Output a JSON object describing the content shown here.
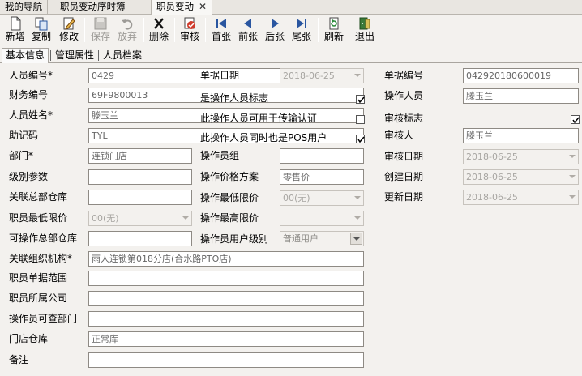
{
  "doc_tabs": {
    "nav": "我的导航",
    "list": "职员变动序时簿",
    "active": "职员变动",
    "close": "✕"
  },
  "toolbar": {
    "new": "新增",
    "copy": "复制",
    "edit": "修改",
    "save": "保存",
    "discard": "放弃",
    "delete": "删除",
    "audit": "审核",
    "first": "首张",
    "prev": "前张",
    "next": "后张",
    "last": "尾张",
    "refresh": "刷新",
    "exit": "退出"
  },
  "subtabs": {
    "basic": "基本信息",
    "mgmt": "管理属性",
    "archive": "人员档案"
  },
  "form": {
    "col1": {
      "emp_no_label": "人员编号*",
      "emp_no": "0429",
      "fin_no_label": "财务编号",
      "fin_no": "69F9800013",
      "name_label": "人员姓名*",
      "name": "滕玉兰",
      "mnemonic_label": "助记码",
      "mnemonic": "TYL",
      "dept_label": "部门*",
      "dept": "连锁门店",
      "level_label": "级别参数",
      "level": "",
      "hq_wh_label": "关联总部仓库",
      "hq_wh": "",
      "min_price_label": "职员最低限价",
      "min_price": "00(无)",
      "op_hq_wh_label": "可操作总部仓库",
      "op_hq_wh": "",
      "org_label": "关联组织机构*",
      "org": "雨人连锁第018分店(合水路PTO店)",
      "doc_scope_label": "职员单据范围",
      "doc_scope": "",
      "company_label": "职员所属公司",
      "company": "",
      "op_dept_label": "操作员可查部门",
      "op_dept": "",
      "store_wh_label": "门店仓库",
      "store_wh": "正常库",
      "remark_label": "备注",
      "remark": ""
    },
    "col2": {
      "doc_date_label": "单据日期",
      "doc_date": "2018-06-25",
      "is_operator_label": "是操作人员标志",
      "is_operator": true,
      "transfer_auth_label": "此操作人员可用于传输认证",
      "transfer_auth": false,
      "pos_user_label": "此操作人员同时也是POS用户",
      "pos_user": true,
      "op_group_label": "操作员组",
      "op_group": "",
      "price_plan_label": "操作价格方案",
      "price_plan": "零售价",
      "op_min_label": "操作最低限价",
      "op_min": "00(无)",
      "op_max_label": "操作最高限价",
      "op_max": "",
      "user_level_label": "操作员用户级别",
      "user_level": "普通用户"
    },
    "col3": {
      "doc_no_label": "单据编号",
      "doc_no": "042920180600019",
      "operator_label": "操作人员",
      "operator": "滕玉兰",
      "audit_flag_label": "审核标志",
      "audit_flag": true,
      "auditor_label": "审核人",
      "auditor": "滕玉兰",
      "audit_date_label": "审核日期",
      "audit_date": "2018-06-25",
      "create_date_label": "创建日期",
      "create_date": "2018-06-25",
      "update_date_label": "更新日期",
      "update_date": "2018-06-25"
    }
  }
}
